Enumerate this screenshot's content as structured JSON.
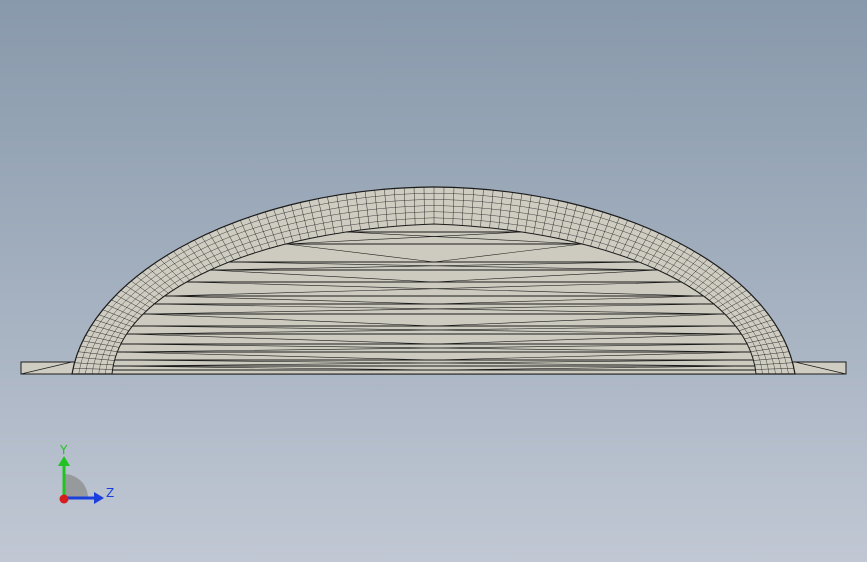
{
  "viewport": {
    "background_top": "#8899ab",
    "background_bottom": "#c1c8d4"
  },
  "model": {
    "fill_color": "#cfcdc2",
    "edge_color": "#1b1b1b",
    "parts": [
      "base-plate",
      "dome-shell"
    ]
  },
  "triad": {
    "x_color": "#d41d1d",
    "y_color": "#22c222",
    "z_color": "#1b3fdc",
    "y_label": "Y",
    "z_label": "Z"
  }
}
